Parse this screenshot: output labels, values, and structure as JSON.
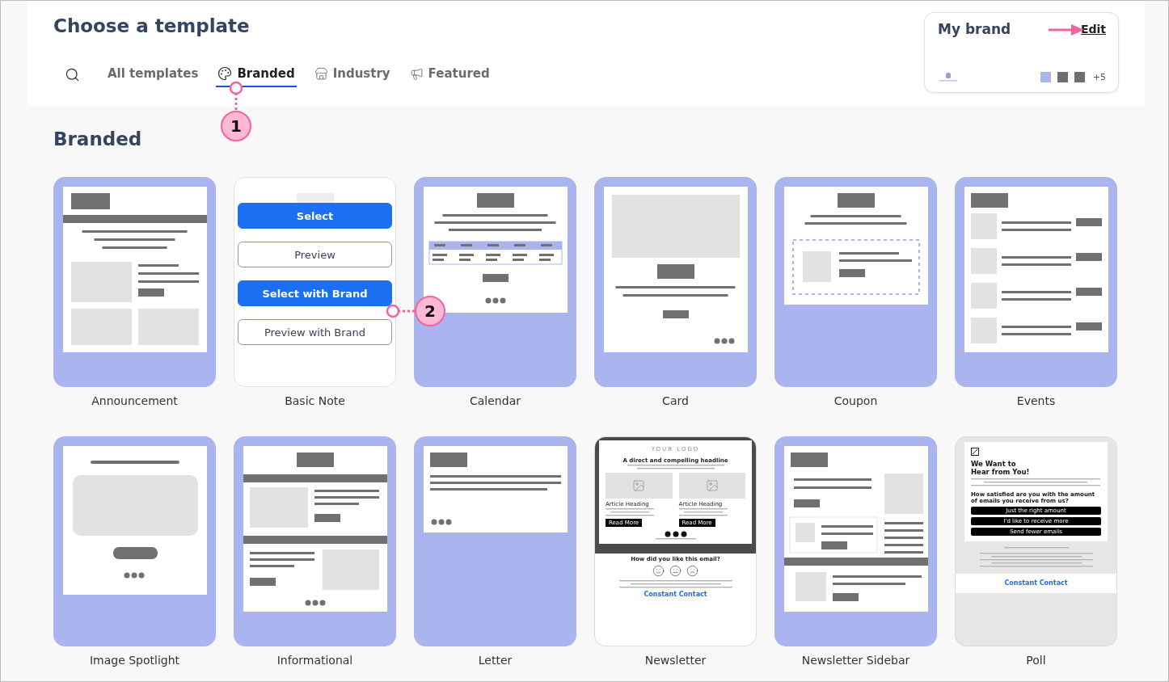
{
  "header": {
    "title": "Choose a template"
  },
  "tabs": [
    {
      "label": "All templates",
      "selected": false
    },
    {
      "label": "Branded",
      "selected": true
    },
    {
      "label": "Industry",
      "selected": false
    },
    {
      "label": "Featured",
      "selected": false
    }
  ],
  "brand": {
    "title": "My brand",
    "edit_link": "Edit",
    "swatches": [
      {
        "color": "#aab4ee"
      },
      {
        "color": "#6f6f6f"
      },
      {
        "color": "#6f6f6f"
      }
    ],
    "more_count": "+5"
  },
  "section_title": "Branded",
  "templates": [
    {
      "name": "Announcement",
      "kind": "announcement",
      "hovered": false
    },
    {
      "name": "Basic Note",
      "kind": "note",
      "hovered": true,
      "actions": [
        {
          "label": "Select",
          "kind": "primary"
        },
        {
          "label": "Preview",
          "kind": "secondary"
        },
        {
          "label": "Select with Brand",
          "kind": "primary"
        },
        {
          "label": "Preview with Brand",
          "kind": "secondary"
        }
      ]
    },
    {
      "name": "Calendar",
      "kind": "calendar",
      "hovered": false
    },
    {
      "name": "Card",
      "kind": "card",
      "hovered": false
    },
    {
      "name": "Coupon",
      "kind": "coupon",
      "hovered": false
    },
    {
      "name": "Events",
      "kind": "events",
      "hovered": false
    },
    {
      "name": "Image Spotlight",
      "kind": "spotlight",
      "hovered": false
    },
    {
      "name": "Informational",
      "kind": "informational",
      "hovered": false
    },
    {
      "name": "Letter",
      "kind": "letter",
      "hovered": false
    },
    {
      "name": "Newsletter",
      "kind": "newsletter",
      "hovered": false,
      "preview": {
        "logo": "YOUR LOGO",
        "headline": "A direct and compelling headline",
        "articles": [
          {
            "heading": "Article Heading",
            "button": "Read More"
          },
          {
            "heading": "Article Heading",
            "button": "Read More"
          }
        ],
        "question": "How did you like this email?",
        "brand_logo": "Constant Contact"
      }
    },
    {
      "name": "Newsletter Sidebar",
      "kind": "sidebar",
      "hovered": false
    },
    {
      "name": "Poll",
      "kind": "poll",
      "hovered": false,
      "preview": {
        "headline": "We Want to Hear from You!",
        "question": "How satisfied are you with the amount of emails you receive from us?",
        "options": [
          "Just the right amount",
          "I'd like to receive more",
          "Send fewer emails"
        ],
        "brand_logo": "Constant Contact"
      }
    }
  ],
  "callouts": [
    {
      "number": "1"
    },
    {
      "number": "2"
    }
  ]
}
